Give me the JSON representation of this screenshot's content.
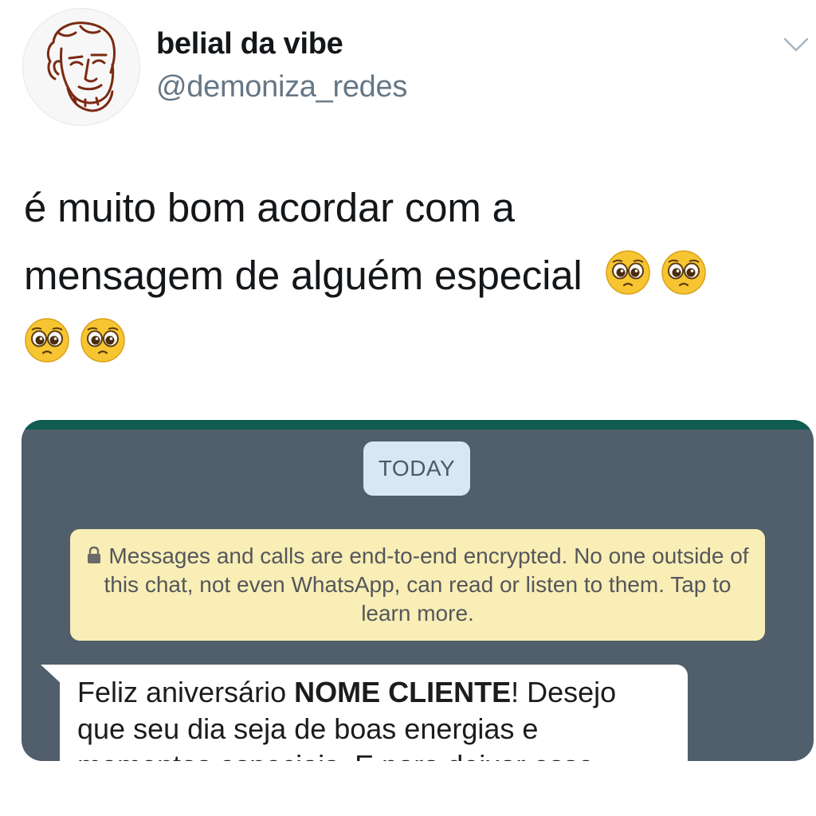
{
  "tweet": {
    "author": {
      "display_name": "belial da vibe",
      "handle": "@demoniza_redes",
      "avatar_icon": "sketched-face-avatar"
    },
    "menu_icon": "chevron-down-icon",
    "text_line1": "é muito bom acordar com a",
    "text_line2": "mensagem de alguém especial",
    "emoji": [
      "pleading-face",
      "pleading-face",
      "pleading-face",
      "pleading-face"
    ]
  },
  "whatsapp": {
    "header_color": "#0f5c50",
    "background_color": "#515e6b",
    "date_chip": "TODAY",
    "encryption_notice": "Messages and calls are end-to-end encrypted. No one outside of this chat, not even WhatsApp, can read or listen to them. Tap to learn more.",
    "encryption_icon": "lock-icon",
    "message": {
      "prefix": "Feliz aniversário ",
      "highlight": "NOME CLIENTE",
      "suffix": "! Desejo que seu dia seja de boas energias e momentos especiais. E para deixar esse"
    }
  }
}
